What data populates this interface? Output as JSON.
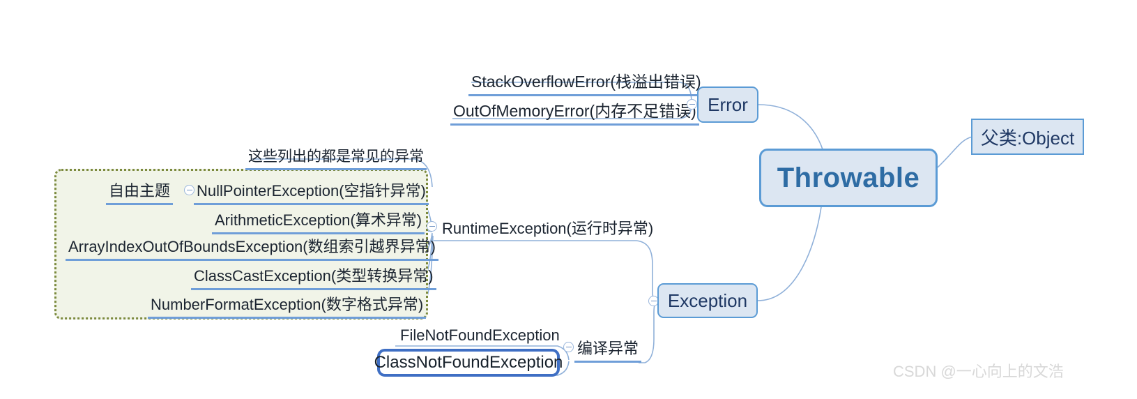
{
  "diagram": {
    "title": "Java Throwable exception hierarchy mind map",
    "root": "Throwable",
    "colors": {
      "node_fill": "#dce6f2",
      "node_border": "#5b9bd5",
      "root_text": "#2e6ca4",
      "branch_line": "#6f9ed8",
      "group_fill": "#f1f4e8",
      "group_border": "#7c8a3e",
      "selected_border": "#3f6fc4",
      "watermark": "#d8d8d8"
    }
  },
  "nodes": {
    "root": {
      "label": "Throwable"
    },
    "parent_note": {
      "label": "父类:Object"
    },
    "error": {
      "label": "Error"
    },
    "exception": {
      "label": "Exception"
    },
    "runtime_exception": {
      "label": "RuntimeException(运行时异常)"
    },
    "compile_exception": {
      "label": "编译异常"
    },
    "free_topic": {
      "label": "自由主题"
    },
    "common_note": {
      "label": "这些列出的都是常见的异常"
    }
  },
  "error_children": [
    {
      "label": "StackOverflowError(栈溢出错误)"
    },
    {
      "label": "OutOfMemoryError(内存不足错误)"
    }
  ],
  "runtime_children": [
    {
      "label": "NullPointerException(空指针异常)"
    },
    {
      "label": "ArithmeticException(算术异常)"
    },
    {
      "label": "ArrayIndexOutOfBoundsException(数组索引越界异常)"
    },
    {
      "label": "ClassCastException(类型转换异常)"
    },
    {
      "label": "NumberFormatException(数字格式异常)"
    }
  ],
  "compile_children": [
    {
      "label": "FileNotFoundException",
      "selected": false
    },
    {
      "label": "ClassNotFoundException",
      "selected": true
    }
  ],
  "watermark": {
    "text": "CSDN @一心向上的文浩"
  }
}
